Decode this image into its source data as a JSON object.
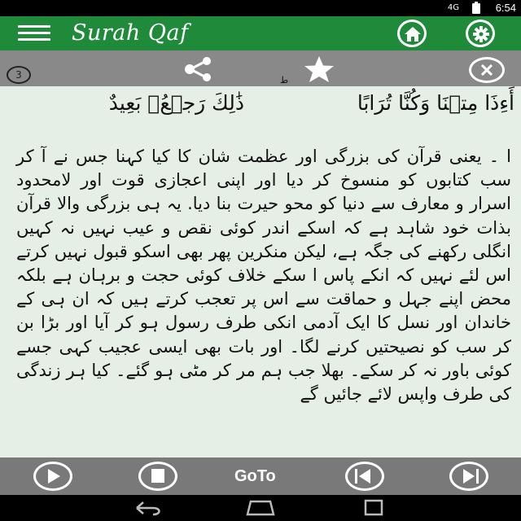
{
  "status_bar": {
    "signal": "4G",
    "time": "6:54"
  },
  "app_bar": {
    "title": "Surah Qaf"
  },
  "toolbar": {
    "verse_number": "3"
  },
  "verse": {
    "right_segment": "أَءِذَا مِتۡنَا وَكُنَّا تُرَابًا",
    "left_segment": "ذَٰلِكَ رَجۡعُۢ بَعِيدٌ",
    "waqf_mark": "ط"
  },
  "translation": {
    "text": "ا ۔ یعنی قرآن کی بزرگی اور عظمت شان کا کیا کہنا جس نے آ کر سب کتابوں کو منسوخ کر دیا اور اپنی اعجازی قوت اور لامحدود اسرار و معارف سے دنیا کو محو حیرت بنا دیا. یہ ہی بزرگی والا قرآن بذات خود شاہد ہے کہ اسکے اندر کوئی نقص و عیب نہیں نہ کہیں انگلی رکھنے کی جگہ ہے، لیکن منکرین پھر بھی اسکو قبول نہیں کرتے اس لئے نہیں کہ انکے پاس ا سکے خلاف کوئی حجت و برہان ہے بلکہ محض اپنے جہل و حماقت سے اس پر تعجب کرتے ہیں کہ ان ہی کے خاندان اور نسل کا ایک آدمی انکی طرف رسول ہو کر آیا اور بڑا بن کر سب کو نصیحتیں کرنے لگا۔ اور بات بھی ایسی عجیب کہی جسے کوئی باور نہ کر سکے۔ بھلا جب ہم مر کر مٹی ہو گئے۔ کیا ہر زندگی کی طرف واپس لائے جائیں گے"
  },
  "controls": {
    "goto_label": "GoTo"
  },
  "colors": {
    "app_bar": "#1e8a3a",
    "background": "#e6efe6",
    "toolbar": "#898989",
    "controls": "#797979"
  }
}
